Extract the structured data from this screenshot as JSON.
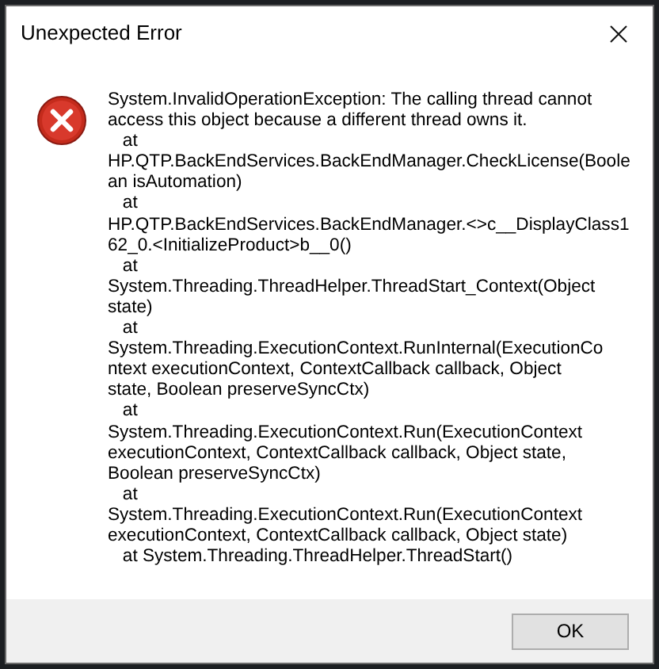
{
  "window": {
    "title": "Unexpected Error"
  },
  "message": "System.InvalidOperationException: The calling thread cannot\naccess this object because a different thread owns it.\n   at\nHP.QTP.BackEndServices.BackEndManager.CheckLicense(Boole\nan isAutomation)\n   at\nHP.QTP.BackEndServices.BackEndManager.<>c__DisplayClass1\n62_0.<InitializeProduct>b__0()\n   at\nSystem.Threading.ThreadHelper.ThreadStart_Context(Object\nstate)\n   at\nSystem.Threading.ExecutionContext.RunInternal(ExecutionCo\nntext executionContext, ContextCallback callback, Object\nstate, Boolean preserveSyncCtx)\n   at\nSystem.Threading.ExecutionContext.Run(ExecutionContext\nexecutionContext, ContextCallback callback, Object state,\nBoolean preserveSyncCtx)\n   at\nSystem.Threading.ExecutionContext.Run(ExecutionContext\nexecutionContext, ContextCallback callback, Object state)\n   at System.Threading.ThreadHelper.ThreadStart()",
  "buttons": [
    "OK"
  ]
}
